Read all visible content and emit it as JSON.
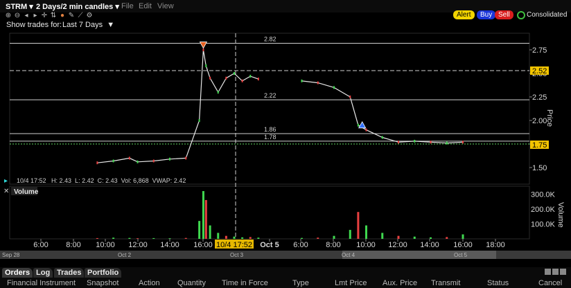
{
  "toolbar": {
    "symbol": "STRM",
    "period": "2 Days/2 min candles",
    "menus": [
      "File",
      "Edit",
      "View"
    ],
    "icons": [
      "zoom-in-icon",
      "zoom-out-icon",
      "arrow-left-icon",
      "arrow-right-icon",
      "crosshair-icon",
      "compare-icon",
      "draw-icon",
      "wrench-icon",
      "scale-icon",
      "settings-icon"
    ],
    "alert": "Alert",
    "buy": "Buy",
    "sell": "Sell",
    "consolidated": "Consolidated",
    "show_trades_for": "Show trades for:",
    "show_trades_value": "Last 7 Days",
    "colors": {
      "alert": "#f2d400",
      "buy": "#1a35d8",
      "sell": "#d81e1e"
    }
  },
  "price_panel": {
    "info_line": "10/4 17:52   H: 2.43  L: 2.42  C: 2.43  Vol: 6,868  VWAP: 2.42",
    "axis_label": "Price",
    "ticks": [
      "2.75",
      "2.50",
      "2.25",
      "2.00",
      "1.75",
      "1.50"
    ],
    "level_labels": [
      "2.82",
      "2.22",
      "1.86",
      "1.78"
    ],
    "tag_crosshair": "2.52",
    "tag_last": "1.75",
    "tag_color": "#f2c400"
  },
  "volume_panel": {
    "title": "Volume",
    "axis_label": "Volume",
    "ticks": [
      "300.0K",
      "200.0K",
      "100.0K"
    ]
  },
  "time_axis": {
    "labels": [
      "6:00",
      "8:00",
      "10:00",
      "12:00",
      "14:00",
      "16:00",
      "Oct 5",
      "6:00",
      "8:00",
      "10:00",
      "12:00",
      "14:00",
      "16:00",
      "18:00"
    ],
    "crosshair_label": "10/4 17:52",
    "overview_labels": [
      "Sep 28",
      "Oct 2",
      "Oct 3",
      "Oct 4",
      "Oct 5"
    ]
  },
  "chart_data": {
    "type": "line",
    "title": "",
    "ylabel": "Price",
    "ylim": [
      1.45,
      2.82
    ],
    "x": [
      "Oct4 09:30",
      "Oct4 10:30",
      "Oct4 11:30",
      "Oct4 12:00",
      "Oct4 13:00",
      "Oct4 14:00",
      "Oct4 15:00",
      "Oct4 15:50",
      "Oct4 16:05",
      "Oct4 16:15",
      "Oct4 16:30",
      "Oct4 17:00",
      "Oct4 17:30",
      "Oct4 18:00",
      "Oct4 18:30",
      "Oct4 19:00",
      "Oct4 19:30",
      "Oct5 06:00",
      "Oct5 07:00",
      "Oct5 08:00",
      "Oct5 09:00",
      "Oct5 09:30",
      "Oct5 10:00",
      "Oct5 11:00",
      "Oct5 12:00",
      "Oct5 13:00",
      "Oct5 14:00",
      "Oct5 15:00",
      "Oct5 16:00"
    ],
    "values": [
      1.55,
      1.57,
      1.6,
      1.56,
      1.57,
      1.59,
      1.6,
      2.0,
      2.75,
      2.58,
      2.45,
      2.3,
      2.45,
      2.5,
      2.42,
      2.47,
      2.44,
      2.42,
      2.4,
      2.35,
      2.25,
      1.95,
      1.9,
      1.82,
      1.77,
      1.78,
      1.77,
      1.76,
      1.77
    ],
    "volume_values": [
      5,
      8,
      6,
      4,
      5,
      4,
      6,
      120,
      320,
      260,
      90,
      40,
      20,
      15,
      10,
      12,
      8,
      6,
      8,
      20,
      60,
      180,
      90,
      40,
      20,
      15,
      10,
      12,
      30
    ],
    "volume_unit": "K",
    "markers": [
      {
        "type": "sell",
        "x": "Oct4 16:05",
        "y": 2.79
      },
      {
        "type": "buy",
        "x": "Oct5 09:45",
        "y": 1.95
      }
    ],
    "levels": [
      2.82,
      2.22,
      1.86,
      1.78
    ],
    "crosshair": {
      "x": "Oct4 17:52",
      "y": 2.52
    },
    "last_price": 1.75
  }
}
